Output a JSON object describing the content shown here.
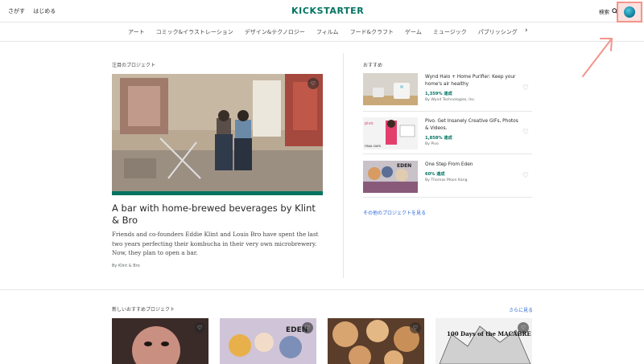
{
  "header": {
    "nav_left": [
      "さがす",
      "はじめる"
    ],
    "logo": "KICKSTARTER",
    "search_label": "検索"
  },
  "categories": [
    "アート",
    "コミック&イラストレーション",
    "デザイン&テクノロジー",
    "フィルム",
    "フード&クラフト",
    "ゲーム",
    "ミュージック",
    "パブリッシング"
  ],
  "featured": {
    "section_label": "注目のプロジェクト",
    "title": "A bar with home-brewed beverages by Klint & Bro",
    "blurb": "Friends and co-founders Eddie Klint and Louis Bro have spent the last two years perfecting their kombucha in their very own microbrewery. Now, they plan to open a bar.",
    "by": "By Klint & Bro"
  },
  "recommended": {
    "section_label": "おすすめ",
    "items": [
      {
        "title": "Wynd Halo + Home Purifier: Keep your home's air healthy",
        "funded": "1,359% 達成",
        "by": "By Wynd Technologies, Inc."
      },
      {
        "title": "Pivo. Get Insanely Creative GIFs, Photos & Videos.",
        "funded": "1,858% 達成",
        "by": "By Pivo"
      },
      {
        "title": "One Step From Eden",
        "funded": "60% 達成",
        "by": "By Thomas Moon Kang"
      }
    ],
    "more_link": "その他のプロジェクトを見る",
    "thumb_labels": {
      "pivo_badge": "FINAL DAYS",
      "eden_logo": "EDEN"
    }
  },
  "new_section": {
    "section_label": "新しいおすすめプロジェクト",
    "see_more": "さらに見る",
    "card_labels": {
      "eden": "EDEN",
      "days": "100 Days of the MACABRE"
    }
  },
  "colors": {
    "brand": "#037362",
    "link": "#2e6ad6",
    "highlight": "#f4948c"
  }
}
